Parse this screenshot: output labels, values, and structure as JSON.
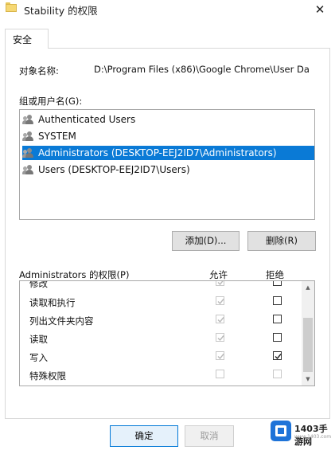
{
  "window": {
    "title": "Stability 的权限",
    "close_glyph": "✕"
  },
  "tabs": [
    {
      "label": "安全"
    }
  ],
  "object": {
    "label": "对象名称:",
    "value": "D:\\Program Files (x86)\\Google Chrome\\User Da"
  },
  "groups": {
    "label": "组或用户名(G):",
    "items": [
      {
        "label": "Authenticated Users",
        "selected": false
      },
      {
        "label": "SYSTEM",
        "selected": false
      },
      {
        "label": "Administrators (DESKTOP-EEJ2ID7\\Administrators)",
        "selected": true
      },
      {
        "label": "Users (DESKTOP-EEJ2ID7\\Users)",
        "selected": false
      }
    ]
  },
  "buttons": {
    "add": "添加(D)...",
    "remove": "删除(R)",
    "ok": "确定",
    "cancel": "取消"
  },
  "permissions": {
    "title": "Administrators 的权限(P)",
    "allow_header": "允许",
    "deny_header": "拒绝",
    "rows": [
      {
        "name": "修改",
        "allow": true,
        "deny": false
      },
      {
        "name": "读取和执行",
        "allow": true,
        "deny": false
      },
      {
        "name": "列出文件夹内容",
        "allow": true,
        "deny": false
      },
      {
        "name": "读取",
        "allow": true,
        "deny": false
      },
      {
        "name": "写入",
        "allow": true,
        "deny": true
      },
      {
        "name": "特殊权限",
        "allow": false,
        "deny": false
      }
    ]
  },
  "watermark": {
    "text": "1403手游网",
    "url": "www.1403.com"
  },
  "colors": {
    "selection": "#0a7ad6",
    "ok_border": "#0078d7"
  }
}
